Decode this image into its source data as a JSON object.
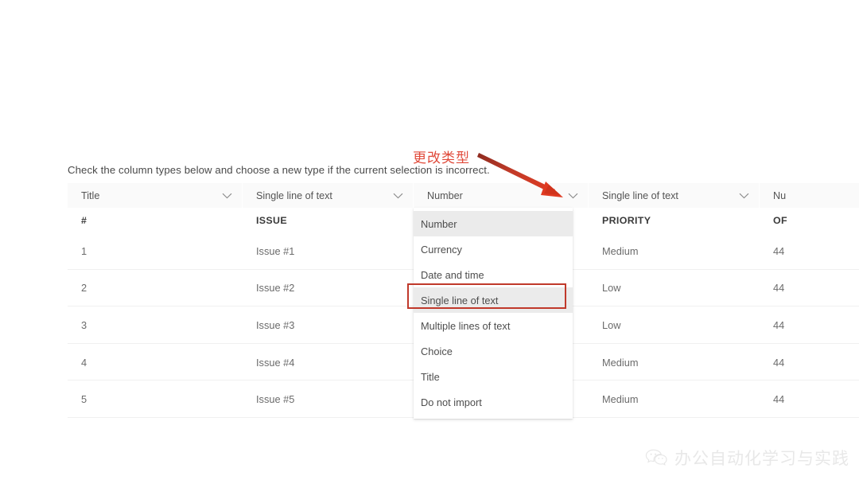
{
  "page": {
    "instruction": "Check the column types below and choose a new type if the current selection is incorrect."
  },
  "annotation": {
    "text": "更改类型",
    "color": "#e04a3a",
    "arrow_name": "red-arrow-pointing-to-number-dropdown"
  },
  "columns": [
    {
      "key": "number",
      "selected_type": "Title",
      "header": "#"
    },
    {
      "key": "issue",
      "selected_type": "Single line of text",
      "header": "ISSUE"
    },
    {
      "key": "count",
      "selected_type": "Number",
      "header": "Number"
    },
    {
      "key": "priority",
      "selected_type": "Single line of text",
      "header": "PRIORITY"
    },
    {
      "key": "clipped",
      "selected_type": "Nu",
      "header": "OF"
    }
  ],
  "rows": [
    {
      "num": "1",
      "issue": "Issue #1",
      "count": "",
      "priority": "Medium",
      "clipped": "44"
    },
    {
      "num": "2",
      "issue": "Issue #2",
      "count": "",
      "priority": "Low",
      "clipped": "44"
    },
    {
      "num": "3",
      "issue": "Issue #3",
      "count": "",
      "priority": "Low",
      "clipped": "44"
    },
    {
      "num": "4",
      "issue": "Issue #4",
      "count": "",
      "priority": "Medium",
      "clipped": "44"
    },
    {
      "num": "5",
      "issue": "Issue #5",
      "count": "",
      "priority": "Medium",
      "clipped": "44"
    }
  ],
  "dropdown": {
    "open": true,
    "owner_column": "count",
    "selected": "Number",
    "highlighted": "Single line of text",
    "items": [
      {
        "label": "Number"
      },
      {
        "label": "Currency"
      },
      {
        "label": "Date and time"
      },
      {
        "label": "Single line of text"
      },
      {
        "label": "Multiple lines of text"
      },
      {
        "label": "Choice"
      },
      {
        "label": "Title"
      },
      {
        "label": "Do not import"
      }
    ]
  },
  "watermark": {
    "text": "办公自动化学习与实践",
    "logo": "wechat-icon"
  },
  "colors": {
    "annotation_red": "#e04a3a",
    "outline_red": "#c0392b",
    "header_bg": "#fafafa",
    "dropdown_selected_bg": "#ebebeb",
    "text_primary": "#3a3a3a",
    "text_secondary": "#6b6b6b"
  }
}
